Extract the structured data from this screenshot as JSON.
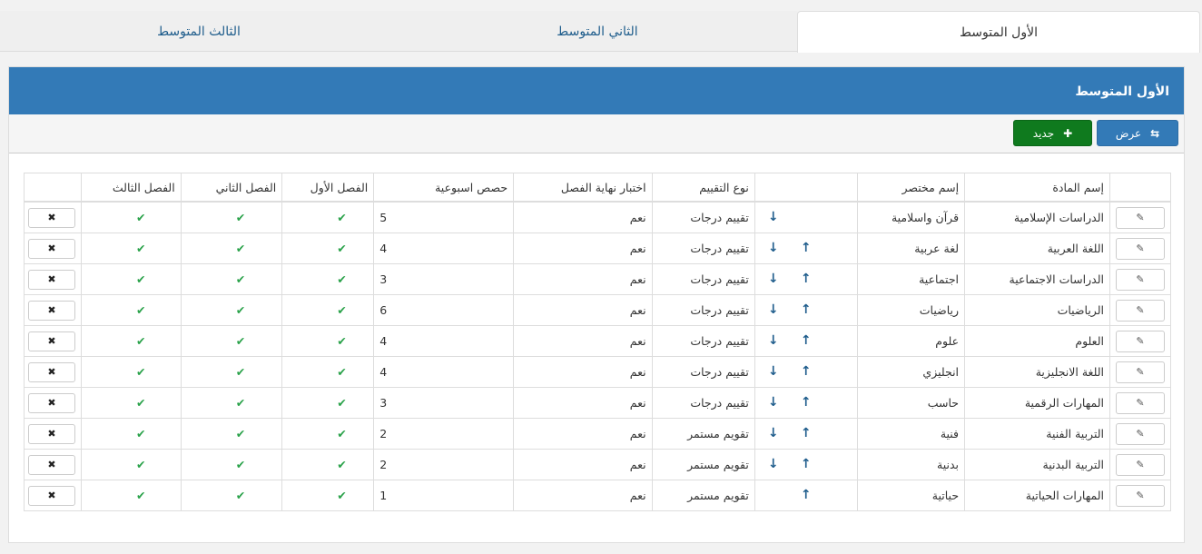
{
  "tabs": [
    {
      "label": "الأول المتوسط",
      "active": true
    },
    {
      "label": "الثاني المتوسط",
      "active": false
    },
    {
      "label": "الثالث المتوسط",
      "active": false
    }
  ],
  "panel": {
    "title": "الأول المتوسط"
  },
  "toolbar": {
    "view_label": "عرض",
    "view_icon": "refresh-icon",
    "new_label": "جديد",
    "new_icon": "plus-icon"
  },
  "table": {
    "headers": [
      "",
      "إسم المادة",
      "إسم مختصر",
      "",
      "نوع التقييم",
      "اختبار نهاية الفصل",
      "حصص اسبوعية",
      "الفصل الأول",
      "الفصل الثاني",
      "الفصل الثالث",
      ""
    ],
    "rows": [
      {
        "name": "الدراسات الإسلامية",
        "short": "قرآن واسلامية",
        "up": false,
        "down": true,
        "eval": "تقييم درجات",
        "final": "نعم",
        "hours": "5",
        "s1": "✔",
        "s2": "✔",
        "s3": "✔"
      },
      {
        "name": "اللغة العربية",
        "short": "لغة عربية",
        "up": true,
        "down": true,
        "eval": "تقييم درجات",
        "final": "نعم",
        "hours": "4",
        "s1": "✔",
        "s2": "✔",
        "s3": "✔"
      },
      {
        "name": "الدراسات الاجتماعية",
        "short": "اجتماعية",
        "up": true,
        "down": true,
        "eval": "تقييم درجات",
        "final": "نعم",
        "hours": "3",
        "s1": "✔",
        "s2": "✔",
        "s3": "✔"
      },
      {
        "name": "الرياضيات",
        "short": "رياضيات",
        "up": true,
        "down": true,
        "eval": "تقييم درجات",
        "final": "نعم",
        "hours": "6",
        "s1": "✔",
        "s2": "✔",
        "s3": "✔"
      },
      {
        "name": "العلوم",
        "short": "علوم",
        "up": true,
        "down": true,
        "eval": "تقييم درجات",
        "final": "نعم",
        "hours": "4",
        "s1": "✔",
        "s2": "✔",
        "s3": "✔"
      },
      {
        "name": "اللغة الانجليزية",
        "short": "انجليزي",
        "up": true,
        "down": true,
        "eval": "تقييم درجات",
        "final": "نعم",
        "hours": "4",
        "s1": "✔",
        "s2": "✔",
        "s3": "✔"
      },
      {
        "name": "المهارات الرقمية",
        "short": "حاسب",
        "up": true,
        "down": true,
        "eval": "تقييم درجات",
        "final": "نعم",
        "hours": "3",
        "s1": "✔",
        "s2": "✔",
        "s3": "✔"
      },
      {
        "name": "التربية الفنية",
        "short": "فنية",
        "up": true,
        "down": true,
        "eval": "تقويم مستمر",
        "final": "نعم",
        "hours": "2",
        "s1": "✔",
        "s2": "✔",
        "s3": "✔"
      },
      {
        "name": "التربية البدنية",
        "short": "بدنية",
        "up": true,
        "down": true,
        "eval": "تقويم مستمر",
        "final": "نعم",
        "hours": "2",
        "s1": "✔",
        "s2": "✔",
        "s3": "✔"
      },
      {
        "name": "المهارات الحياتية",
        "short": "حياتية",
        "up": true,
        "down": false,
        "eval": "تقويم مستمر",
        "final": "نعم",
        "hours": "1",
        "s1": "✔",
        "s2": "✔",
        "s3": "✔"
      }
    ],
    "edit_icon": "edit-icon",
    "delete_icon": "delete-icon",
    "arrow_up": "↑",
    "arrow_down": "↓",
    "edit_glyph": "✎",
    "delete_glyph": "✖"
  },
  "colors": {
    "header_blue": "#337ab7",
    "new_green": "#0f7a1e",
    "check_green": "#2aa24a",
    "arrow_blue": "#1f5d8c"
  }
}
